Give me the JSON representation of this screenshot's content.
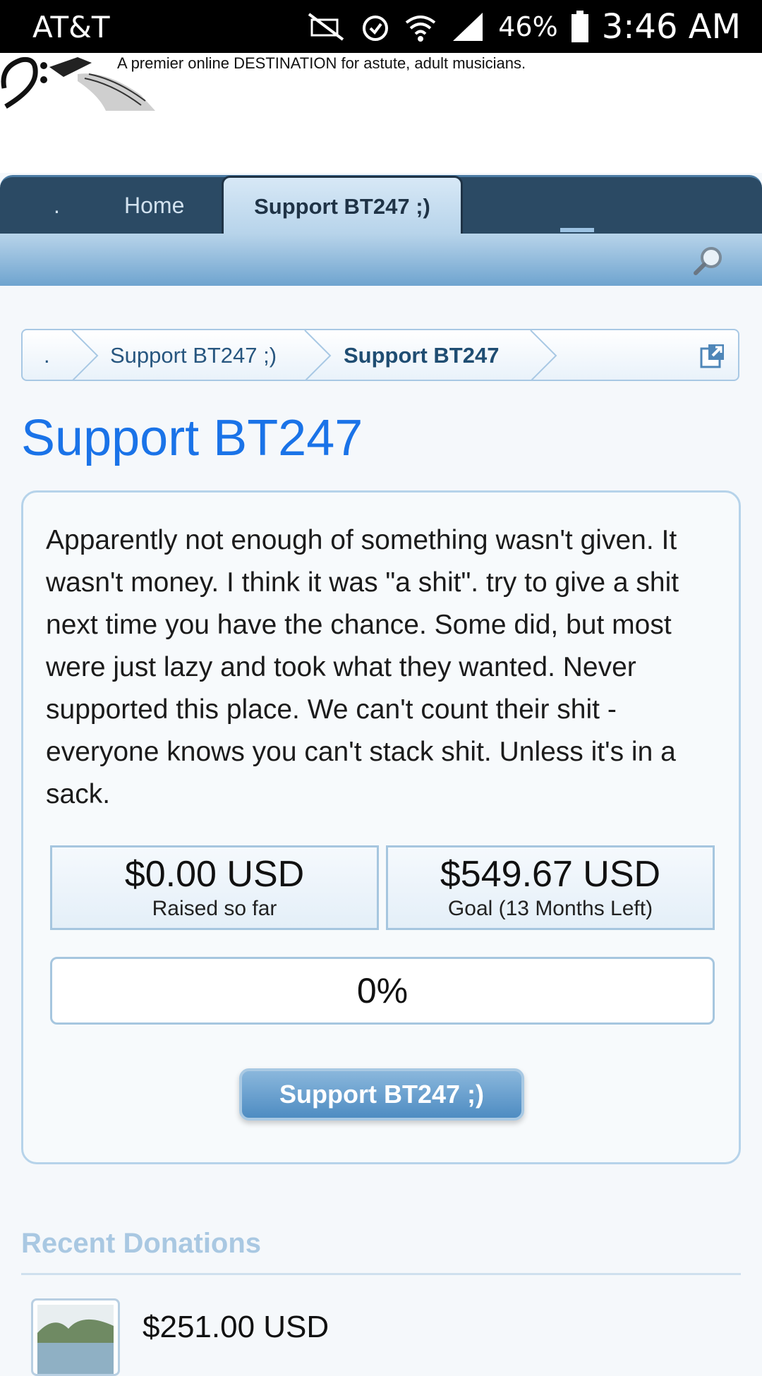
{
  "status_bar": {
    "carrier": "AT&T",
    "battery": "46%",
    "time": "3:46 AM"
  },
  "header": {
    "tagline": "A premier online DESTINATION for astute, adult musicians."
  },
  "nav": {
    "tabs": [
      ".",
      "Home"
    ],
    "active_tab": "Support BT247 ;)"
  },
  "breadcrumb": {
    "items": [
      ".",
      "Support BT247 ;)",
      "Support BT247"
    ]
  },
  "page": {
    "title": "Support BT247"
  },
  "campaign": {
    "description": "Apparently not enough of something wasn't given. It wasn't money. I think it was \"a shit\". try to give a shit next time you have the chance. Some did, but most were just lazy and took what they wanted. Never supported this place. We can't count their shit - everyone knows you can't stack shit. Unless it's in a sack.",
    "raised_amount": "$0.00 USD",
    "raised_label": "Raised so far",
    "goal_amount": "$549.67 USD",
    "goal_label": "Goal (13 Months Left)",
    "progress_text": "0%",
    "progress_fraction": 0,
    "support_button": "Support BT247 ;)"
  },
  "recent_donations": {
    "heading": "Recent Donations",
    "items": [
      {
        "amount": "$251.00 USD"
      }
    ]
  },
  "colors": {
    "title_blue": "#1a73e8",
    "nav_dark": "#2b4a64",
    "accent_light": "#b6d3ea"
  }
}
